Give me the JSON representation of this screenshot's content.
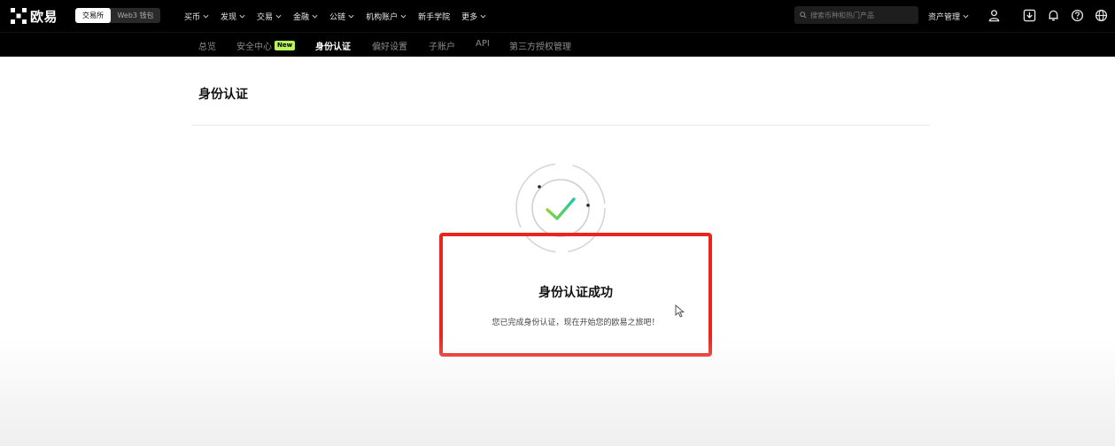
{
  "header": {
    "logo_text": "欧易",
    "mode_tabs": [
      {
        "label": "交易所",
        "active": true
      },
      {
        "label": "Web3 钱包",
        "active": false
      }
    ],
    "nav": [
      {
        "label": "买币",
        "has_dropdown": true
      },
      {
        "label": "发现",
        "has_dropdown": true
      },
      {
        "label": "交易",
        "has_dropdown": true
      },
      {
        "label": "金融",
        "has_dropdown": true
      },
      {
        "label": "公链",
        "has_dropdown": true
      },
      {
        "label": "机构账户",
        "has_dropdown": true
      },
      {
        "label": "新手学院",
        "has_dropdown": false
      },
      {
        "label": "更多",
        "has_dropdown": true
      }
    ],
    "search_placeholder": "搜索币种和热门产品",
    "asset_management": "资产管理",
    "icons": [
      "user-icon",
      "download-icon",
      "bell-icon",
      "help-icon",
      "globe-icon"
    ]
  },
  "subnav": {
    "items": [
      {
        "label": "总览",
        "active": false
      },
      {
        "label": "安全中心",
        "active": false,
        "badge": "New"
      },
      {
        "label": "身份认证",
        "active": true
      },
      {
        "label": "偏好设置",
        "active": false
      },
      {
        "label": "子账户",
        "active": false
      },
      {
        "label": "API",
        "active": false
      },
      {
        "label": "第三方授权管理",
        "active": false
      }
    ]
  },
  "page": {
    "title": "身份认证",
    "success_title": "身份认证成功",
    "success_desc": "您已完成身份认证，现在开始您的欧易之旅吧！"
  },
  "colors": {
    "header_bg": "#000000",
    "badge_green": "#b7f35a",
    "highlight_red": "#e8261e",
    "check_green": "#8bd63a",
    "check_teal": "#26c6a2"
  }
}
